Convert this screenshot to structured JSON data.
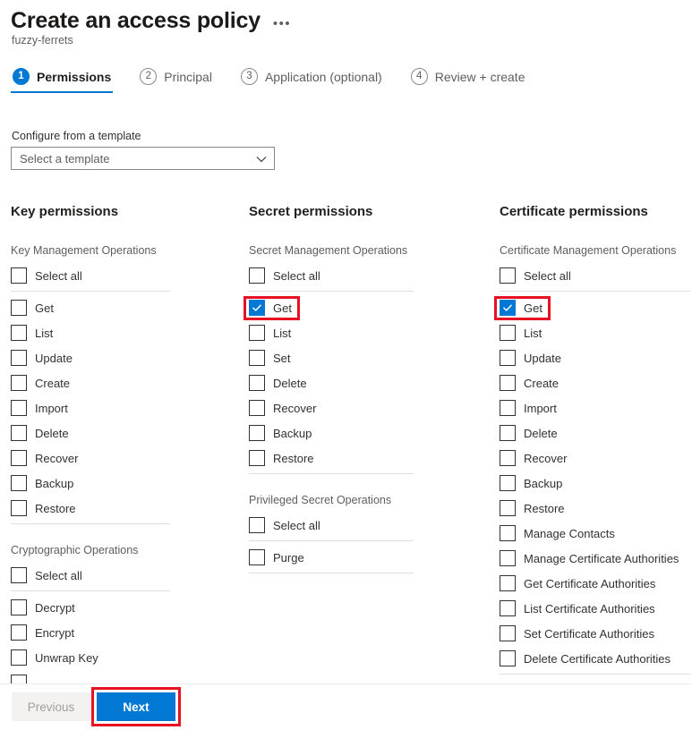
{
  "header": {
    "title": "Create an access policy",
    "more_label": "•••",
    "subtitle": "fuzzy-ferrets"
  },
  "steps": [
    {
      "number": "1",
      "label": "Permissions",
      "active": true
    },
    {
      "number": "2",
      "label": "Principal",
      "active": false
    },
    {
      "number": "3",
      "label": "Application (optional)",
      "active": false
    },
    {
      "number": "4",
      "label": "Review + create",
      "active": false
    }
  ],
  "template": {
    "label": "Configure from a template",
    "value": "Select a template",
    "icon": "chevron-down-icon"
  },
  "columns": {
    "key": {
      "title": "Key permissions",
      "groups": [
        {
          "title": "Key Management Operations",
          "select_all": "Select all",
          "items": [
            "Get",
            "List",
            "Update",
            "Create",
            "Import",
            "Delete",
            "Recover",
            "Backup",
            "Restore"
          ]
        },
        {
          "title": "Cryptographic Operations",
          "select_all": "Select all",
          "items": [
            "Decrypt",
            "Encrypt",
            "Unwrap Key",
            ""
          ]
        }
      ]
    },
    "secret": {
      "title": "Secret permissions",
      "groups": [
        {
          "title": "Secret Management Operations",
          "select_all": "Select all",
          "items": [
            "Get",
            "List",
            "Set",
            "Delete",
            "Recover",
            "Backup",
            "Restore"
          ],
          "checked": [
            "Get"
          ]
        },
        {
          "title": "Privileged Secret Operations",
          "select_all": "Select all",
          "items": [
            "Purge"
          ]
        }
      ]
    },
    "certificate": {
      "title": "Certificate permissions",
      "groups": [
        {
          "title": "Certificate Management Operations",
          "select_all": "Select all",
          "items": [
            "Get",
            "List",
            "Update",
            "Create",
            "Import",
            "Delete",
            "Recover",
            "Backup",
            "Restore",
            "Manage Contacts",
            "Manage Certificate Authorities",
            "Get Certificate Authorities",
            "List Certificate Authorities",
            "Set Certificate Authorities",
            "Delete Certificate Authorities"
          ],
          "checked": [
            "Get"
          ]
        }
      ]
    }
  },
  "footer": {
    "previous_label": "Previous",
    "next_label": "Next"
  },
  "colors": {
    "accent": "#0078d4",
    "annotation": "#e81123",
    "text": "#323130",
    "muted": "#605e5c"
  }
}
